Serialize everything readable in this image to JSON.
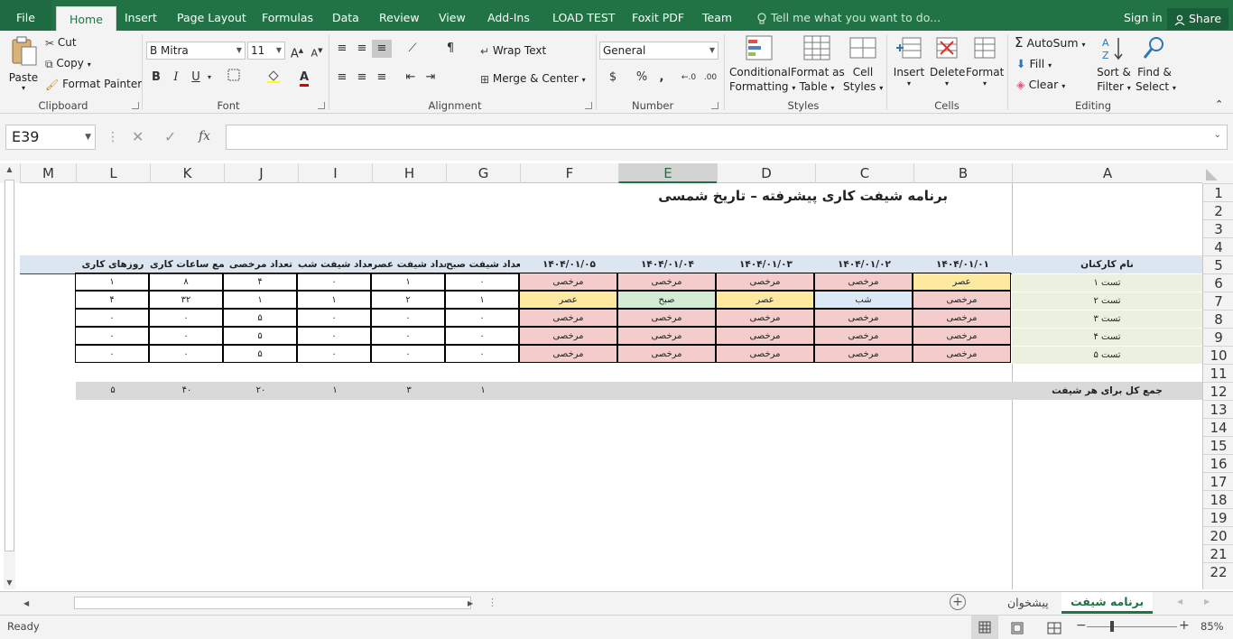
{
  "ribbon_tabs": [
    "File",
    "Home",
    "Insert",
    "Page Layout",
    "Formulas",
    "Data",
    "Review",
    "View",
    "Add-Ins",
    "LOAD TEST",
    "Foxit PDF",
    "Team"
  ],
  "tell_me": "Tell me what you want to do...",
  "sign_in": "Sign in",
  "share": "Share",
  "clipboard": {
    "paste": "Paste",
    "cut": "Cut",
    "copy": "Copy",
    "format_painter": "Format Painter",
    "label": "Clipboard"
  },
  "font": {
    "name": "B Mitra",
    "size": "11",
    "label": "Font",
    "bold": "B",
    "italic": "I",
    "underline": "U"
  },
  "alignment": {
    "wrap": "Wrap Text",
    "merge": "Merge & Center",
    "label": "Alignment"
  },
  "number": {
    "format": "General",
    "label": "Number",
    "currency": "$",
    "percent": "%",
    "comma": ","
  },
  "styles": {
    "conditional_1": "Conditional",
    "conditional_2": "Formatting",
    "format_table_1": "Format as",
    "format_table_2": "Table",
    "cell_styles_1": "Cell",
    "cell_styles_2": "Styles",
    "label": "Styles"
  },
  "cells": {
    "insert": "Insert",
    "delete": "Delete",
    "format": "Format",
    "label": "Cells"
  },
  "editing": {
    "autosum": "AutoSum",
    "fill": "Fill",
    "clear": "Clear",
    "sort_1": "Sort &",
    "sort_2": "Filter",
    "find_1": "Find &",
    "find_2": "Select",
    "label": "Editing"
  },
  "name_box": "E39",
  "fx": "fx",
  "columns": [
    "M",
    "L",
    "K",
    "J",
    "I",
    "H",
    "G",
    "F",
    "E",
    "D",
    "C",
    "B",
    "A"
  ],
  "rows": [
    "1",
    "2",
    "3",
    "4",
    "5",
    "6",
    "7",
    "8",
    "9",
    "10",
    "11",
    "12",
    "13",
    "14",
    "15",
    "16",
    "17",
    "18",
    "19",
    "20",
    "21",
    "22"
  ],
  "sheet": {
    "title": "برنامه شیفت کاری پیشرفته – تاریخ شمسی",
    "headers": {
      "A": "نام کارکنان",
      "B": "۱۴۰۴/۰۱/۰۱",
      "C": "۱۴۰۴/۰۱/۰۲",
      "D": "۱۴۰۴/۰۱/۰۳",
      "E": "۱۴۰۴/۰۱/۰۴",
      "F": "۱۴۰۴/۰۱/۰۵",
      "G": "تعداد شیفت صبح",
      "H": "تعداد شیفت عصر",
      "I": "تعداد شیفت شب",
      "J": "تعداد مرخصی",
      "K": "جمع ساعات کاری",
      "L": "روزهای کاری"
    },
    "employees": [
      {
        "A": "تست ۱",
        "B": "عصر",
        "C": "مرخصی",
        "D": "مرخصی",
        "E": "مرخصی",
        "F": "مرخصی",
        "G": "۰",
        "H": "۱",
        "I": "۰",
        "J": "۴",
        "K": "۸",
        "L": "۱"
      },
      {
        "A": "تست ۲",
        "B": "مرخصی",
        "C": "شب",
        "D": "عصر",
        "E": "صبح",
        "F": "عصر",
        "G": "۱",
        "H": "۲",
        "I": "۱",
        "J": "۱",
        "K": "۳۲",
        "L": "۴"
      },
      {
        "A": "تست ۳",
        "B": "مرخصی",
        "C": "مرخصی",
        "D": "مرخصی",
        "E": "مرخصی",
        "F": "مرخصی",
        "G": "۰",
        "H": "۰",
        "I": "۰",
        "J": "۵",
        "K": "۰",
        "L": "۰"
      },
      {
        "A": "تست ۴",
        "B": "مرخصی",
        "C": "مرخصی",
        "D": "مرخصی",
        "E": "مرخصی",
        "F": "مرخصی",
        "G": "۰",
        "H": "۰",
        "I": "۰",
        "J": "۵",
        "K": "۰",
        "L": "۰"
      },
      {
        "A": "تست ۵",
        "B": "مرخصی",
        "C": "مرخصی",
        "D": "مرخصی",
        "E": "مرخصی",
        "F": "مرخصی",
        "G": "۰",
        "H": "۰",
        "I": "۰",
        "J": "۵",
        "K": "۰",
        "L": "۰"
      }
    ],
    "totals": {
      "A": "جمع کل برای هر شیفت",
      "G": "۱",
      "H": "۳",
      "I": "۱",
      "J": "۲۰",
      "K": "۴۰",
      "L": "۵"
    }
  },
  "shift_colors": {
    "عصر": "#fde9a0",
    "مرخصی": "#f4cccc",
    "شب": "#dbe8f5",
    "صبح": "#d3ecd3"
  },
  "sheet_tabs": [
    "برنامه شیفت",
    "پیشخوان"
  ],
  "status": {
    "ready": "Ready",
    "zoom": "85%"
  }
}
